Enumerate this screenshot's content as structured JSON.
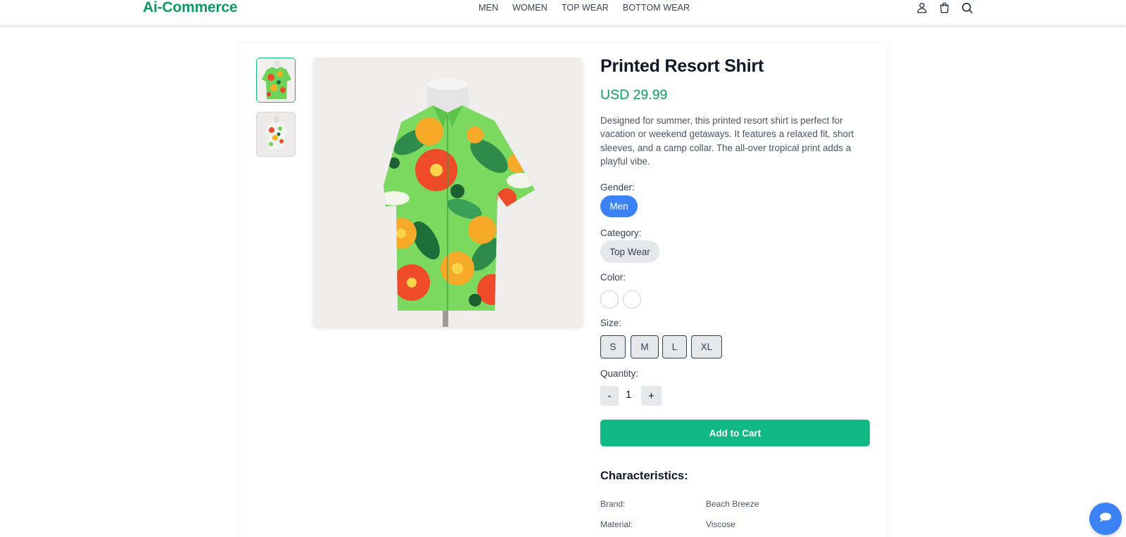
{
  "header": {
    "logo": "Ai-Commerce",
    "nav": [
      "MEN",
      "WOMEN",
      "TOP WEAR",
      "BOTTOM WEAR"
    ],
    "icons": [
      "user-icon",
      "shopping-bag-icon",
      "search-icon"
    ]
  },
  "product": {
    "title": "Printed Resort Shirt",
    "price": "USD 29.99",
    "description": "Designed for summer, this printed resort shirt is perfect for vacation or weekend getaways. It features a relaxed fit, short sleeves, and a camp collar. The all-over tropical print adds a playful vibe.",
    "gender_label": "Gender:",
    "gender": "Men",
    "category_label": "Category:",
    "category": "Top Wear",
    "color_label": "Color:",
    "colors": [
      "#ffffff",
      "#ffffff"
    ],
    "size_label": "Size:",
    "sizes": [
      "S",
      "M",
      "L",
      "XL"
    ],
    "quantity_label": "Quantity:",
    "quantity_minus": "-",
    "quantity": "1",
    "quantity_plus": "+",
    "add_to_cart": "Add to Cart"
  },
  "characteristics": {
    "title": "Characteristics:",
    "rows": [
      {
        "key": "Brand:",
        "value": "Beach Breeze"
      },
      {
        "key": "Material:",
        "value": "Viscose"
      }
    ]
  },
  "colors": {
    "brand": "#0e9a62",
    "accent_blue": "#3b82f6",
    "cart_green": "#10b981"
  }
}
